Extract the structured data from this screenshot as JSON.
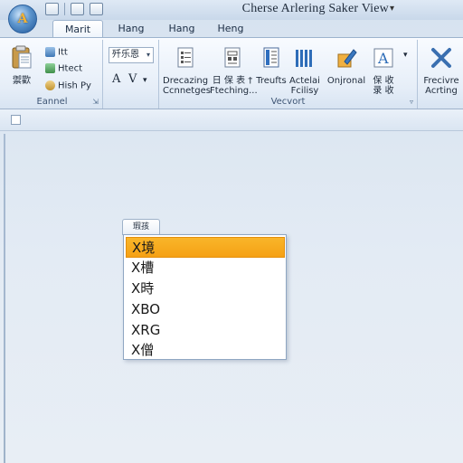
{
  "window": {
    "title": "Cherse Arlering Saker View",
    "title_dropdown_glyph": "▾"
  },
  "app_orb": {
    "glyph": "A"
  },
  "tabs": [
    {
      "label": "Marit",
      "active": true
    },
    {
      "label": "Hang",
      "active": false
    },
    {
      "label": "Hang",
      "active": false
    },
    {
      "label": "Heng",
      "active": false
    }
  ],
  "ribbon": {
    "group1": {
      "label": "Eannel",
      "paste_label": "禦歡",
      "items": [
        "Itt",
        "Htect",
        "Hish Py"
      ]
    },
    "group2": {
      "combo_value": "歼乐恩",
      "combo_arrow": "▾",
      "font_btn_a": "A",
      "font_btn_v": "V",
      "font_btn_arrow": "▾"
    },
    "group3": {
      "label": "Vecvort",
      "buttons": [
        {
          "line1": "Drecazing",
          "line2": "Ccnnetges"
        },
        {
          "line1": "日 保 表 †",
          "line2": "Fteching..."
        },
        {
          "line1": "Treufts",
          "line2": ""
        },
        {
          "line1": "Actelai",
          "line2": "Fcilisy"
        },
        {
          "line1": "Onjronal",
          "line2": ""
        },
        {
          "line1": "保 收",
          "line2": "录 收"
        }
      ],
      "more_arrow": "▾"
    },
    "group4": {
      "button": {
        "line1": "Frecivre",
        "line2": "Acrting"
      }
    }
  },
  "dropdown": {
    "header": "瑕孩",
    "items": [
      {
        "label": "X境",
        "selected": true
      },
      {
        "label": "X槽",
        "selected": false
      },
      {
        "label": "X時",
        "selected": false
      },
      {
        "label": "XBO",
        "selected": false
      },
      {
        "label": "XRG",
        "selected": false
      },
      {
        "label": "X僧",
        "selected": false
      }
    ]
  },
  "colors": {
    "accent_selected": "#f5a115",
    "ribbon_bg": "#e6eef8",
    "border": "#9db3cd"
  }
}
